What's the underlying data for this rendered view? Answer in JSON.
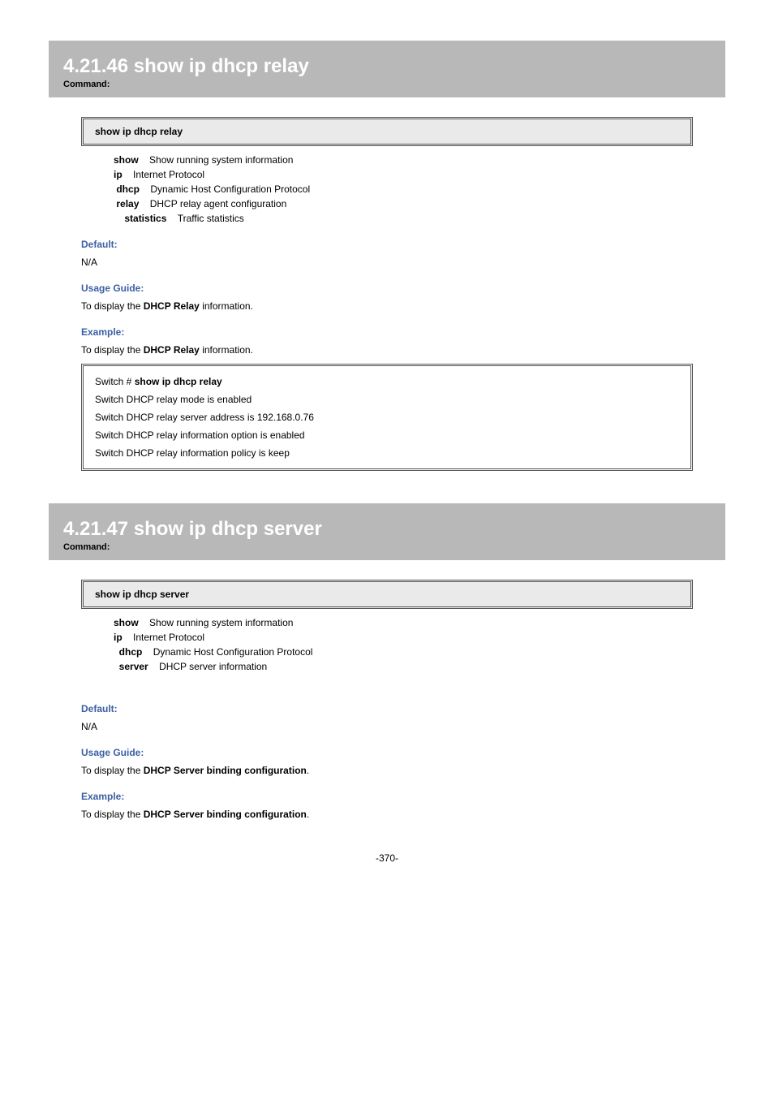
{
  "sections": [
    {
      "title": "4.21.46 show ip dhcp relay",
      "subtitle": "Command:",
      "code": "show ip dhcp relay",
      "params": [
        {
          "term": "show",
          "desc": "Show running system information"
        },
        {
          "term": "ip",
          "desc": "Internet Protocol"
        },
        {
          "term": "dhcp",
          "desc": "Dynamic Host Configuration Protocol"
        },
        {
          "term": "relay",
          "desc": "DHCP relay agent configuration"
        },
        {
          "term": "statistics",
          "desc": "Traffic statistics"
        }
      ],
      "labels": {
        "default": "Default:",
        "default_val": "N/A",
        "usage": "Usage Guide:",
        "usage_pre": "To display the ",
        "usage_bold": "DHCP Relay",
        "usage_post": " information.",
        "example": "Example:",
        "example_pre": "To display the ",
        "example_bold": "DHCP Relay",
        "example_post": " information."
      },
      "output": [
        "Switch # show ip dhcp relay",
        "Switch DHCP relay mode is enabled",
        "Switch DHCP relay server address is 192.168.0.76",
        "Switch DHCP relay information option is enabled",
        "Switch DHCP relay information policy is keep"
      ],
      "output_cmd_bold": "show ip dhcp relay"
    },
    {
      "title": "4.21.47 show ip dhcp server",
      "subtitle": "Command:",
      "code": "show ip dhcp server",
      "params": [
        {
          "term": "show",
          "desc": "Show running system information"
        },
        {
          "term": "ip",
          "desc": "Internet Protocol"
        },
        {
          "term": "dhcp",
          "desc": "Dynamic Host Configuration Protocol"
        },
        {
          "term": "server",
          "desc": "DHCP server information"
        }
      ],
      "labels": {
        "default": "Default:",
        "default_val": "N/A",
        "usage": "Usage Guide:",
        "usage_pre": "To display the ",
        "usage_bold": "DHCP Server binding configuration",
        "usage_post": ".",
        "example": "Example:",
        "example_pre": "To display the ",
        "example_bold": "DHCP Server binding configuration",
        "example_post": "."
      }
    }
  ],
  "page_number": "-370-"
}
